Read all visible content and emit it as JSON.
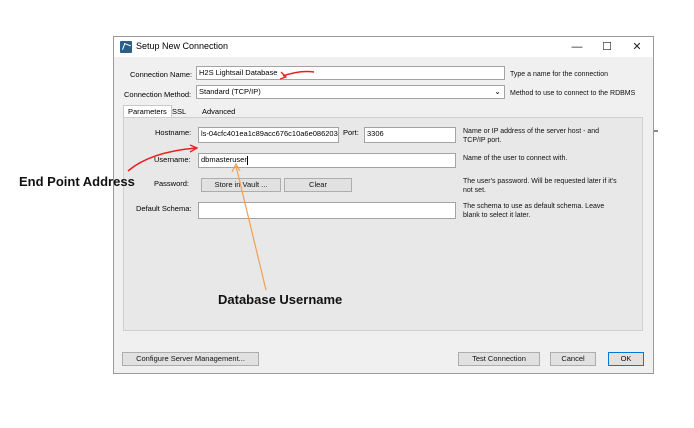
{
  "window": {
    "title": "Setup New Connection",
    "minimize_glyph": "—",
    "maximize_glyph": "☐",
    "close_glyph": "✕"
  },
  "connection_name": {
    "label": "Connection Name:",
    "value": "H2S Lightsail Database",
    "help": "Type a name for the connection"
  },
  "connection_method": {
    "label": "Connection Method:",
    "value": "Standard (TCP/IP)",
    "help": "Method to use to connect to the RDBMS"
  },
  "tabs": [
    {
      "label": "Parameters"
    },
    {
      "label": "SSL"
    },
    {
      "label": "Advanced"
    }
  ],
  "parameters": {
    "hostname": {
      "label": "Hostname:",
      "value": "ls-04cfc401ea1c89acc676c10a6e086203",
      "help_line1": "Name or IP address of the server host - and",
      "help_line2": "TCP/IP port."
    },
    "port": {
      "label": "Port:",
      "value": "3306"
    },
    "username": {
      "label": "Username:",
      "value": "dbmasteruser",
      "help": "Name of the user to connect with."
    },
    "password": {
      "label": "Password:",
      "store_button": "Store in Vault ...",
      "clear_button": "Clear",
      "help_line1": "The user's password. Will be requested later if it's",
      "help_line2": "not set."
    },
    "default_schema": {
      "label": "Default Schema:",
      "value": "",
      "help_line1": "The schema to use as default schema. Leave",
      "help_line2": "blank to select it later."
    }
  },
  "footer": {
    "configure_button": "Configure Server Management...",
    "test_button": "Test Connection",
    "cancel_button": "Cancel",
    "ok_button": "OK"
  },
  "annotations": {
    "endpoint": "End Point Address",
    "username": "Database Username",
    "color": "#e8201c",
    "arrow_color": "#f0a050"
  }
}
